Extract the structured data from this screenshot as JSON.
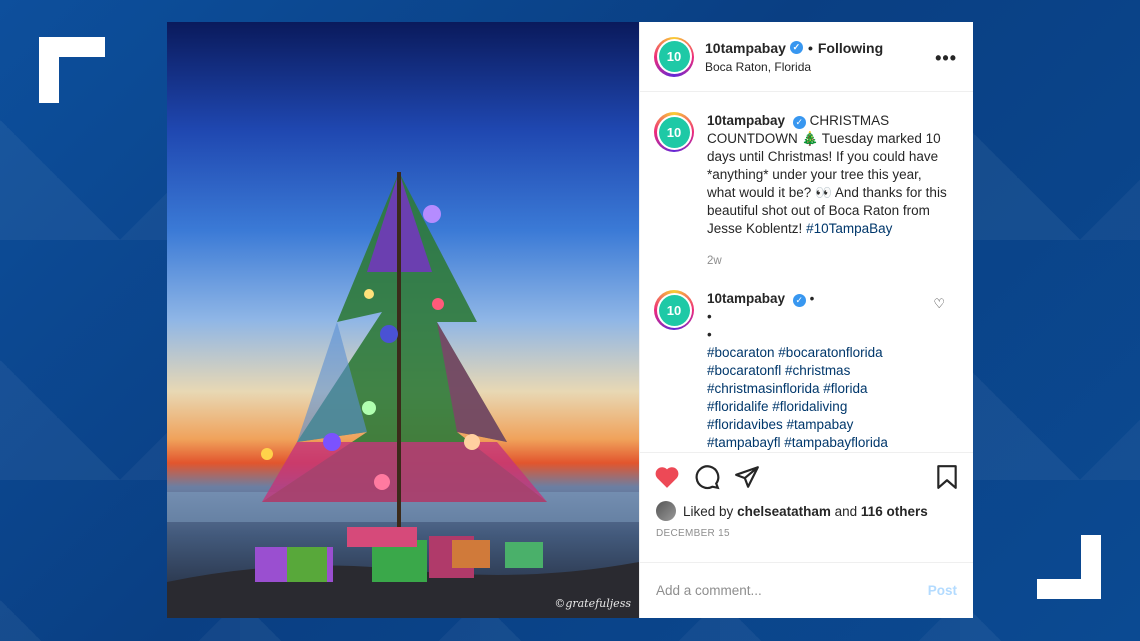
{
  "account": {
    "username": "10tampabay",
    "avatar_text": "10",
    "follow_status": "Following",
    "location": "Boca Raton, Florida"
  },
  "caption": {
    "username": "10tampabay",
    "text": "CHRISTMAS COUNTDOWN 🎄 Tuesday marked 10 days until Christmas! If you could have *anything* under your tree this year, what would it be? 👀 And thanks for this beautiful shot out of Boca Raton from Jesse Koblentz!",
    "hashtag": "#10TampaBay",
    "time": "2w"
  },
  "comment": {
    "username": "10tampabay",
    "bullet_lines": [
      "•",
      "•",
      "•"
    ],
    "hashtag_lines": [
      "#bocaraton #bocaratonflorida",
      "#bocaratonfl #christmas",
      "#christmasinflorida #florida",
      "#floridalife #floridaliving",
      "#floridavibes #tampabay",
      "#tampabayfl #tampabayflorida"
    ]
  },
  "likes": {
    "prefix": "Liked by",
    "user": "chelseatatham",
    "joiner": "and",
    "others": "116 others"
  },
  "date": "DECEMBER 15",
  "add_comment": {
    "placeholder": "Add a comment...",
    "post_label": "Post"
  },
  "photo": {
    "watermark": "©gratefuljess"
  },
  "icons": {
    "like": "heart-icon",
    "comment": "comment-icon",
    "share": "share-icon",
    "save": "bookmark-icon",
    "more": "more-icon",
    "verified": "verified-icon"
  },
  "colors": {
    "liked_heart": "#ed4956",
    "verified": "#3897f0",
    "hashtag": "#00376b",
    "brand_teal": "#1ec9a6"
  }
}
